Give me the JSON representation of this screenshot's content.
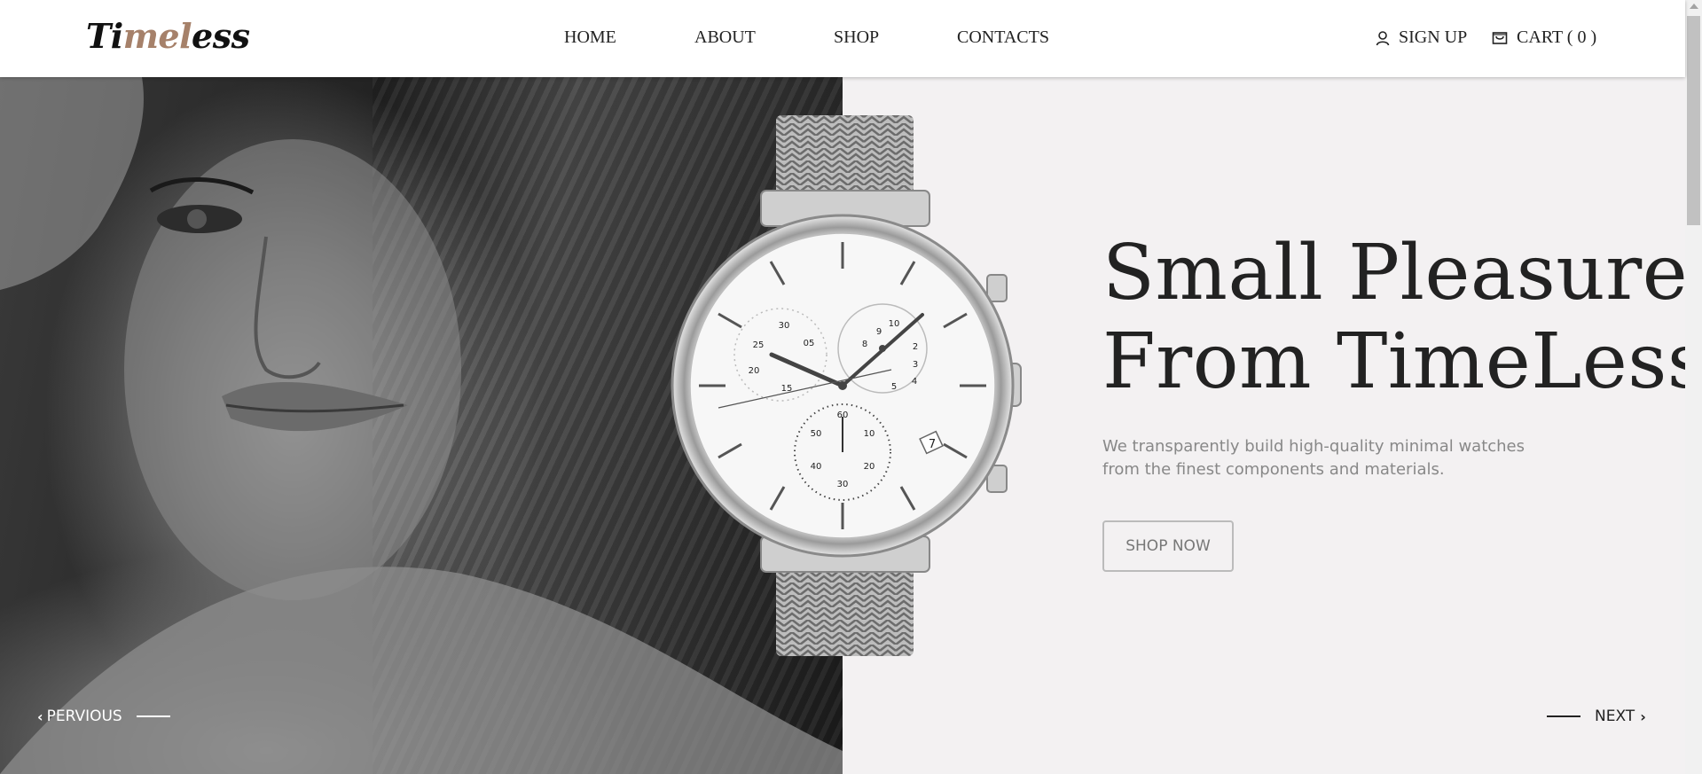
{
  "header": {
    "logo": {
      "part1": "Ti",
      "part2": "me",
      "accent": "l",
      "part3": "ess"
    },
    "nav": [
      "HOME",
      "ABOUT",
      "SHOP",
      "CONTACTS"
    ],
    "sign_up": "SIGN UP",
    "cart": "CART ( 0 )"
  },
  "hero": {
    "headline_line1": "Small Pleasures",
    "headline_line2": "From TimeLess",
    "subtitle_line1": "We transparently build high-quality minimal watches",
    "subtitle_line2": "from the finest components and materials.",
    "cta": "SHOP NOW"
  },
  "slider": {
    "previous": "PERVIOUS",
    "next": "NEXT"
  },
  "watch_dial": {
    "left_subdial": [
      "30",
      "05",
      "25",
      "20",
      "15"
    ],
    "right_subdial": [
      "10",
      "9",
      "8",
      "2",
      "3",
      "5",
      "4"
    ],
    "bottom_subdial": [
      "60",
      "50",
      "10",
      "40",
      "20",
      "30"
    ],
    "date": "7"
  },
  "colors": {
    "logo_accent": "#a6816a",
    "background_right": "#f3f1f2",
    "text_dark": "#222222",
    "text_muted": "#888888"
  },
  "icons": {
    "user": "user-icon",
    "cart": "cart-icon",
    "prev": "chevron-left-icon",
    "next": "chevron-right-icon"
  }
}
